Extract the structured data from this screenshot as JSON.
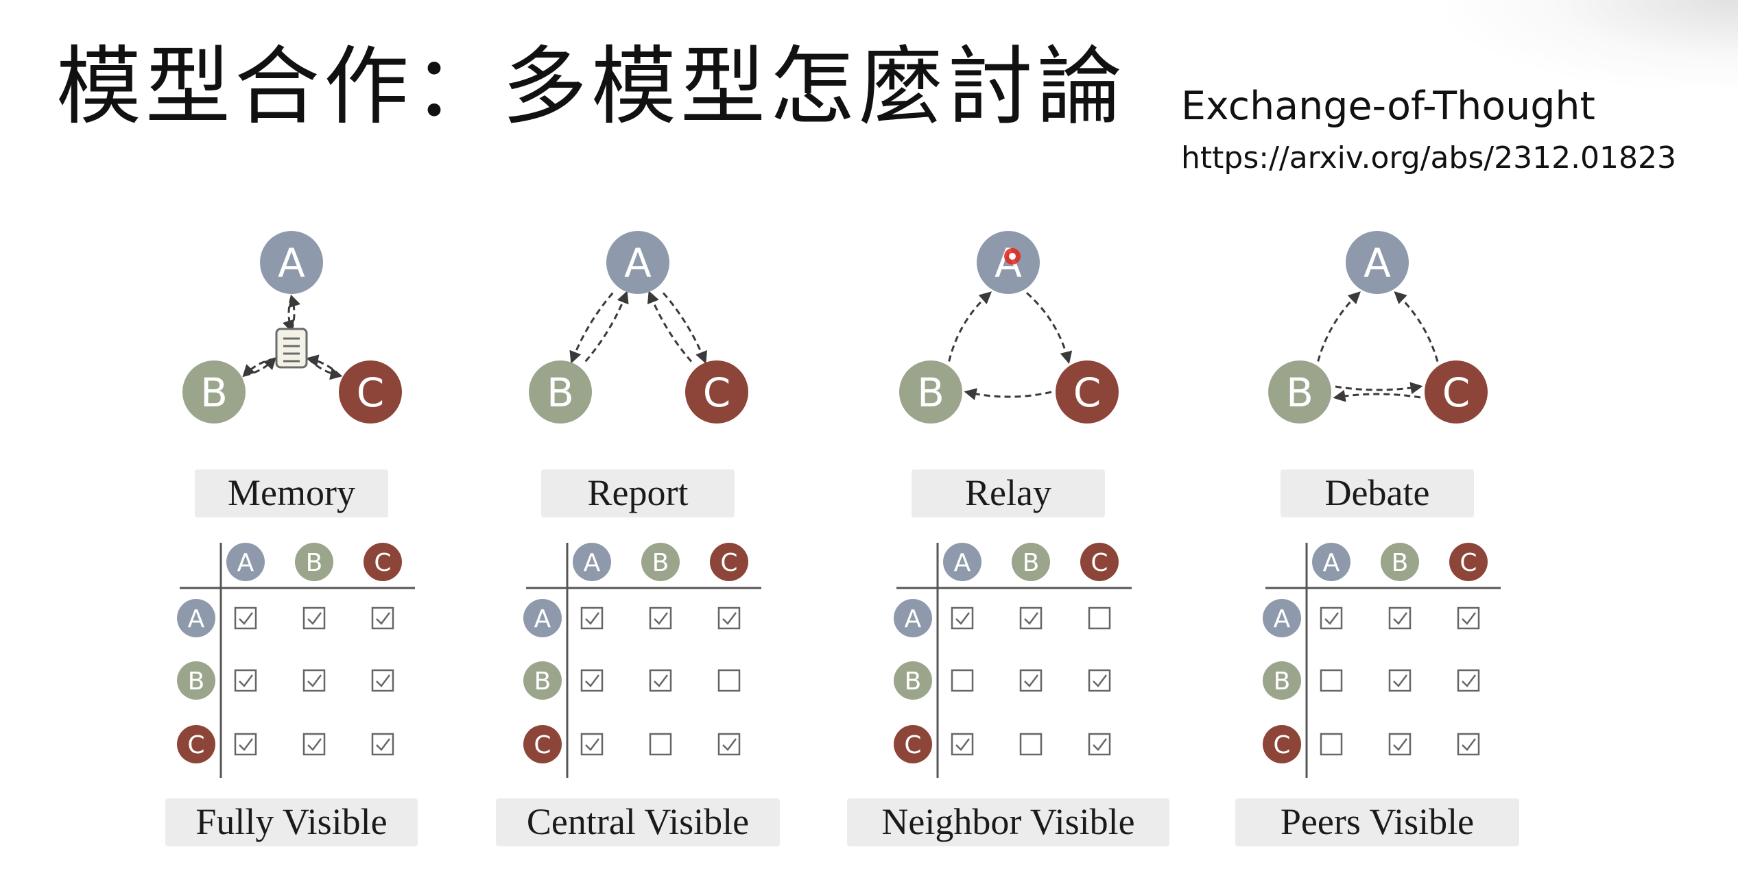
{
  "title": "模型合作：多模型怎麼討論",
  "reference": {
    "name": "Exchange-of-Thought",
    "url": "https://arxiv.org/abs/2312.01823"
  },
  "colors": {
    "A": "#8e9aab",
    "B": "#9aa58c",
    "C": "#8c4538",
    "label_bg": "#ececec",
    "pointer": "#e3261b"
  },
  "node_labels": [
    "A",
    "B",
    "C"
  ],
  "panels": [
    {
      "mode": "Memory",
      "visibility": "Fully Visible",
      "matrix": [
        [
          true,
          true,
          true
        ],
        [
          true,
          true,
          true
        ],
        [
          true,
          true,
          true
        ]
      ]
    },
    {
      "mode": "Report",
      "visibility": "Central Visible",
      "matrix": [
        [
          true,
          true,
          true
        ],
        [
          true,
          true,
          false
        ],
        [
          true,
          false,
          true
        ]
      ]
    },
    {
      "mode": "Relay",
      "visibility": "Neighbor Visible",
      "matrix": [
        [
          true,
          true,
          false
        ],
        [
          false,
          true,
          true
        ],
        [
          true,
          false,
          true
        ]
      ]
    },
    {
      "mode": "Debate",
      "visibility": "Peers Visible",
      "matrix": [
        [
          true,
          true,
          true
        ],
        [
          false,
          true,
          true
        ],
        [
          false,
          true,
          true
        ]
      ]
    }
  ]
}
